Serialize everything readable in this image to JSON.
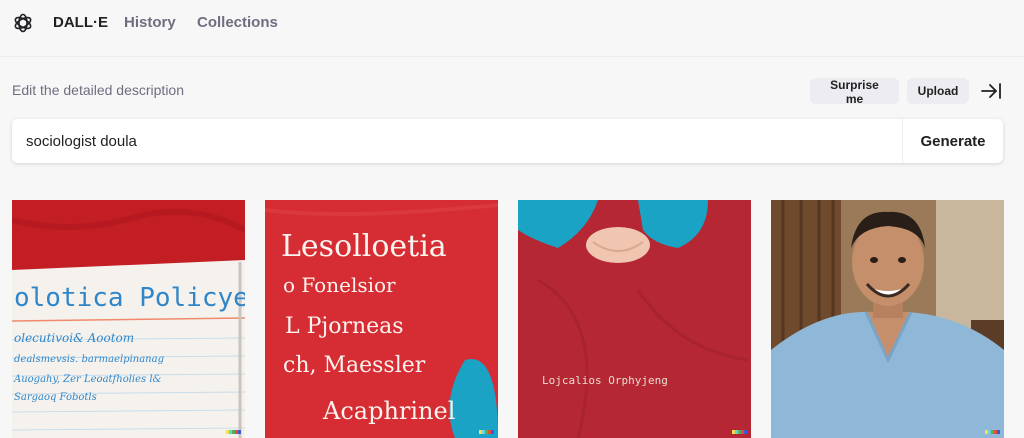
{
  "nav": {
    "brand": "DALL·E",
    "history": "History",
    "collections": "Collections"
  },
  "editor": {
    "description_label": "Edit the detailed description",
    "surprise_label": "Surprise me",
    "upload_label": "Upload",
    "prompt_value": "sociologist doula",
    "generate_label": "Generate"
  },
  "images": [
    {
      "lines": [
        "olotica Policyel",
        "olecutivoi& Aootom",
        "dealsmevsis. barmaelpinanag",
        "Auogahy, Zer Leoatfholies l&",
        "Sargaoq Fobotls"
      ]
    },
    {
      "lines": [
        "Lesolloetia",
        "o Fonelsior",
        "L Pjorneas",
        "ch, Maessler",
        "Acaphrinel"
      ]
    },
    {
      "lines": [
        "Lojcalios Orphyjeng"
      ]
    },
    {
      "lines": []
    }
  ],
  "colors": {
    "accent_red": "#d52d33",
    "teal_fabric": "#1aa3c4",
    "scrub_blue": "#8fb8d8"
  }
}
